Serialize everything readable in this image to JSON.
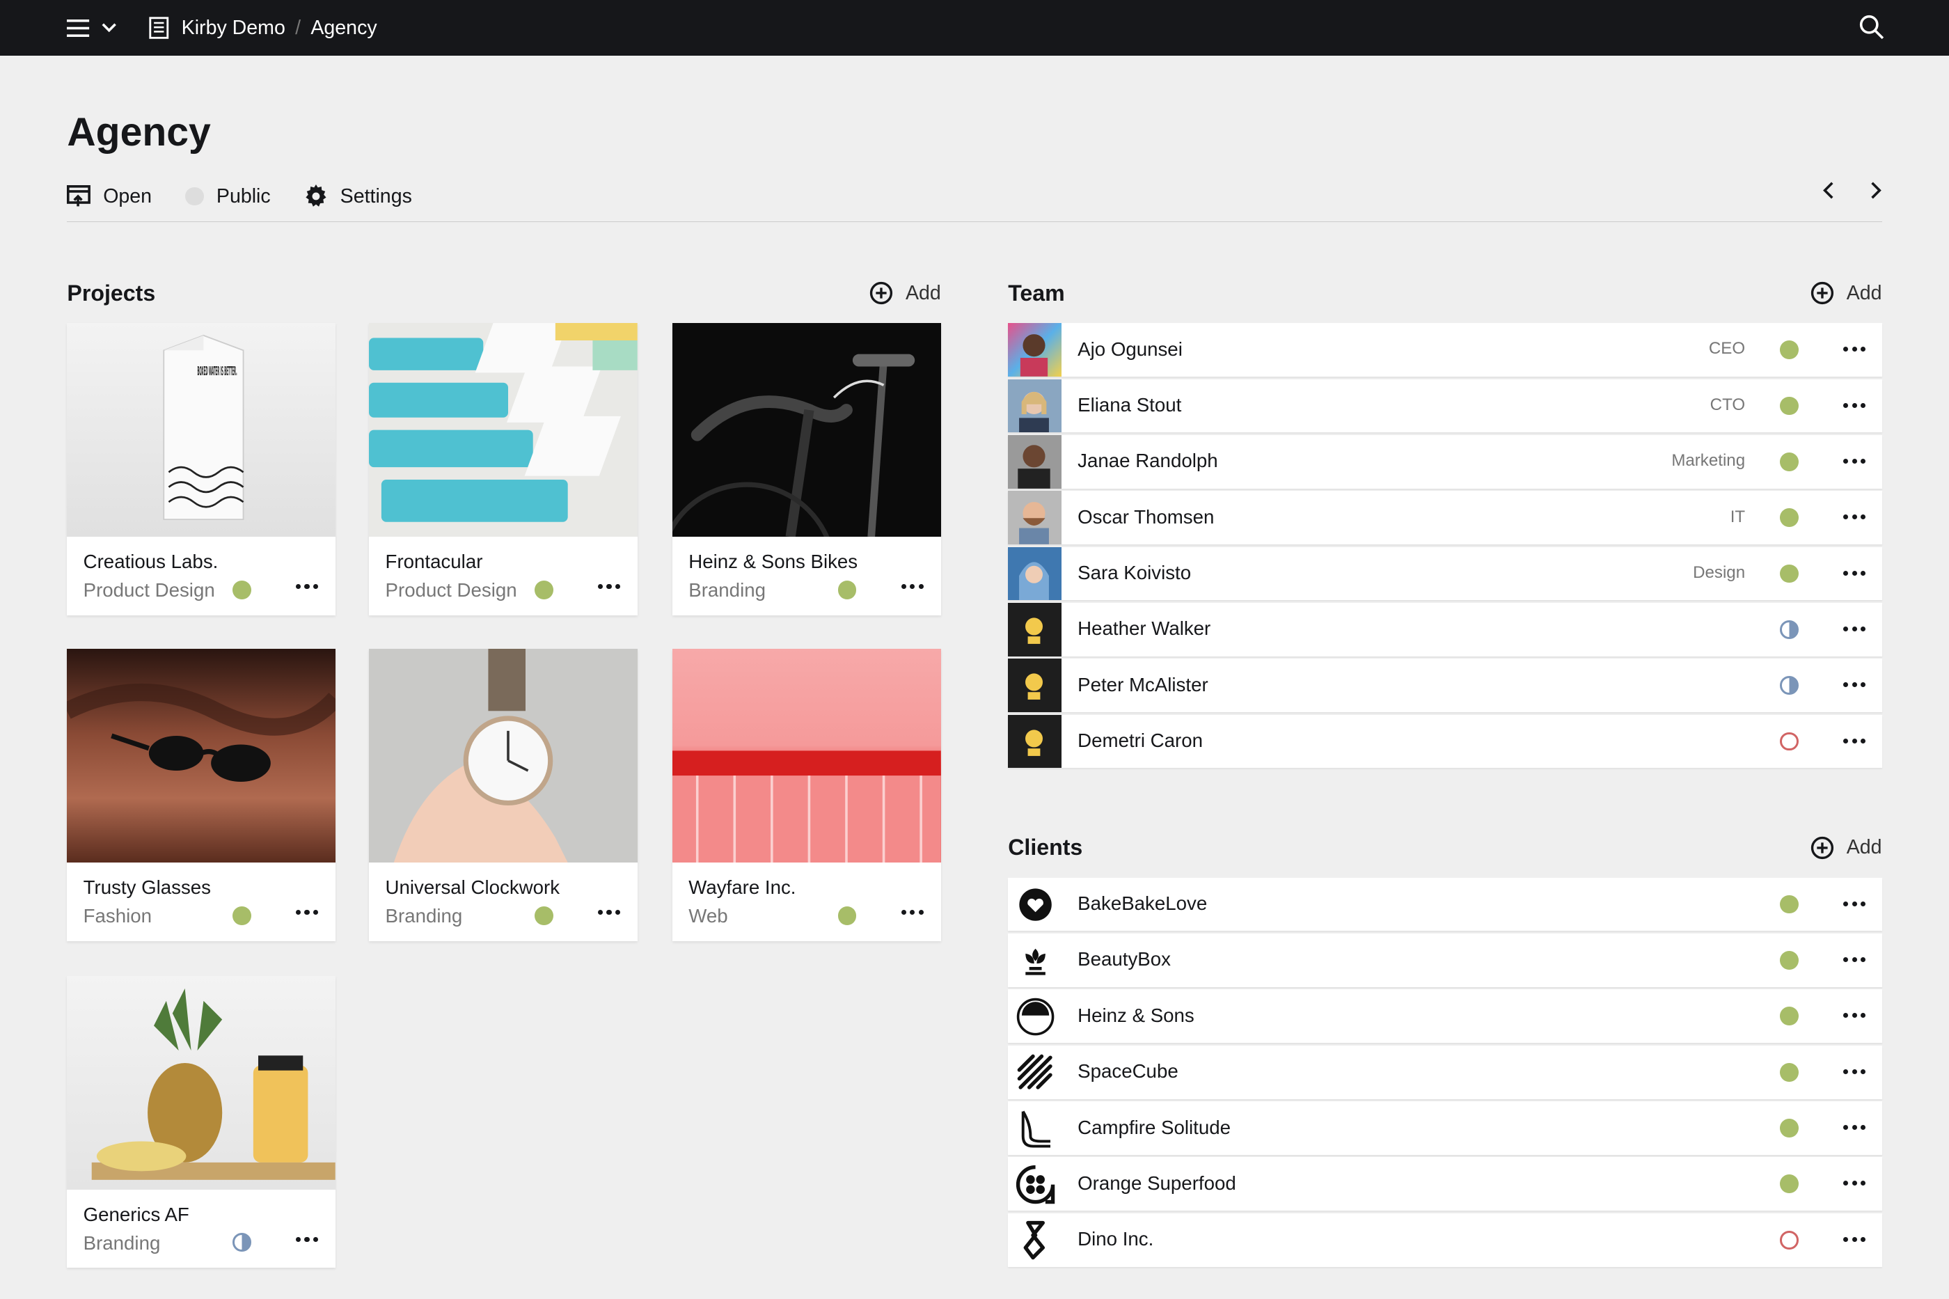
{
  "topbar": {
    "site": "Kirby Demo",
    "separator": "/",
    "current": "Agency"
  },
  "page": {
    "title": "Agency",
    "actions": {
      "open": "Open",
      "public": "Public",
      "settings": "Settings"
    }
  },
  "projects": {
    "heading": "Projects",
    "add_label": "Add",
    "items": [
      {
        "title": "Creatious Labs.",
        "category": "Product Design",
        "status": "published"
      },
      {
        "title": "Frontacular",
        "category": "Product Design",
        "status": "published"
      },
      {
        "title": "Heinz & Sons Bikes",
        "category": "Branding",
        "status": "published"
      },
      {
        "title": "Trusty Glasses",
        "category": "Fashion",
        "status": "published"
      },
      {
        "title": "Universal Clockwork",
        "category": "Branding",
        "status": "published"
      },
      {
        "title": "Wayfare Inc.",
        "category": "Web",
        "status": "published"
      },
      {
        "title": "Generics AF",
        "category": "Branding",
        "status": "unlisted"
      }
    ],
    "box_text": "BOXED WATER IS BETTER."
  },
  "team": {
    "heading": "Team",
    "add_label": "Add",
    "members": [
      {
        "name": "Ajo Ogunsei",
        "role": "CEO",
        "status": "published"
      },
      {
        "name": "Eliana Stout",
        "role": "CTO",
        "status": "published"
      },
      {
        "name": "Janae Randolph",
        "role": "Marketing",
        "status": "published"
      },
      {
        "name": "Oscar Thomsen",
        "role": "IT",
        "status": "published"
      },
      {
        "name": "Sara Koivisto",
        "role": "Design",
        "status": "published"
      },
      {
        "name": "Heather Walker",
        "role": "",
        "status": "unlisted"
      },
      {
        "name": "Peter McAlister",
        "role": "",
        "status": "unlisted"
      },
      {
        "name": "Demetri Caron",
        "role": "",
        "status": "draft"
      }
    ]
  },
  "clients": {
    "heading": "Clients",
    "add_label": "Add",
    "items": [
      {
        "name": "BakeBakeLove",
        "status": "published"
      },
      {
        "name": "BeautyBox",
        "status": "published"
      },
      {
        "name": "Heinz & Sons",
        "status": "published"
      },
      {
        "name": "SpaceCube",
        "status": "published"
      },
      {
        "name": "Campfire Solitude",
        "status": "published"
      },
      {
        "name": "Orange Superfood",
        "status": "published"
      },
      {
        "name": "Dino Inc.",
        "status": "draft"
      }
    ]
  },
  "colors": {
    "published": "#a7bd68",
    "unlisted": "#7b95b8",
    "draft": "#d16464",
    "topbar": "#16171a"
  }
}
